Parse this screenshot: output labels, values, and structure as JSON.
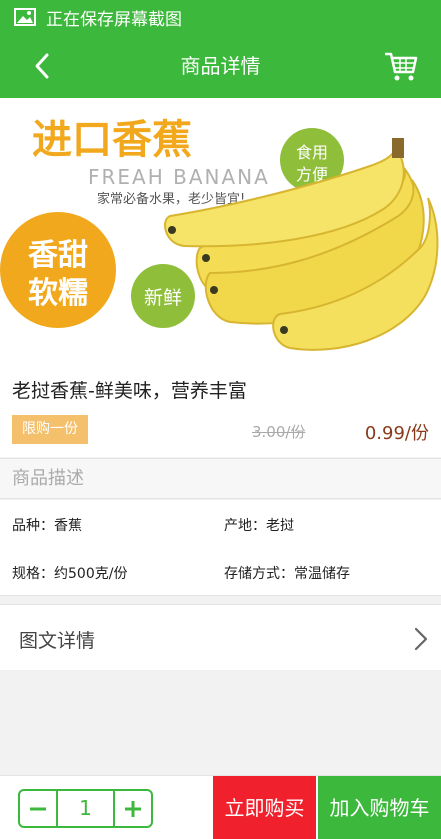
{
  "status_bar": {
    "icon": "image-icon",
    "text": "正在保存屏幕截图"
  },
  "header": {
    "title": "商品详情",
    "back_icon": "chevron-left-icon",
    "cart_icon": "shopping-cart-icon"
  },
  "banner": {
    "headline": "进口香蕉",
    "sub_en": "FREAH BANANA",
    "slogan": "家常必备水果，老少皆宜!",
    "badge_eat": [
      "食用",
      "方便"
    ],
    "badge_sweet": [
      "香甜",
      "软糯"
    ],
    "badge_fresh": "新鲜"
  },
  "product": {
    "name": "老挝香蕉-鲜美味，营养丰富",
    "limit_label": "限购一份",
    "original_price": "3.00/份",
    "price": "0.99/份"
  },
  "description": {
    "heading": "商品描述",
    "variety": "品种：香蕉",
    "origin": "产地：老挝",
    "spec": "规格：约500克/份",
    "storage": "存储方式：常温储存"
  },
  "detail_link": {
    "label": "图文详情",
    "icon": "chevron-right-icon"
  },
  "bottom_bar": {
    "quantity": "1",
    "buy_now": "立即购买",
    "add_to_cart": "加入购物车"
  },
  "colors": {
    "brand_green": "#3cb83c",
    "buy_red": "#f0202c",
    "limit_orange": "#f5c06b",
    "price_brown": "#8a3a1a"
  }
}
